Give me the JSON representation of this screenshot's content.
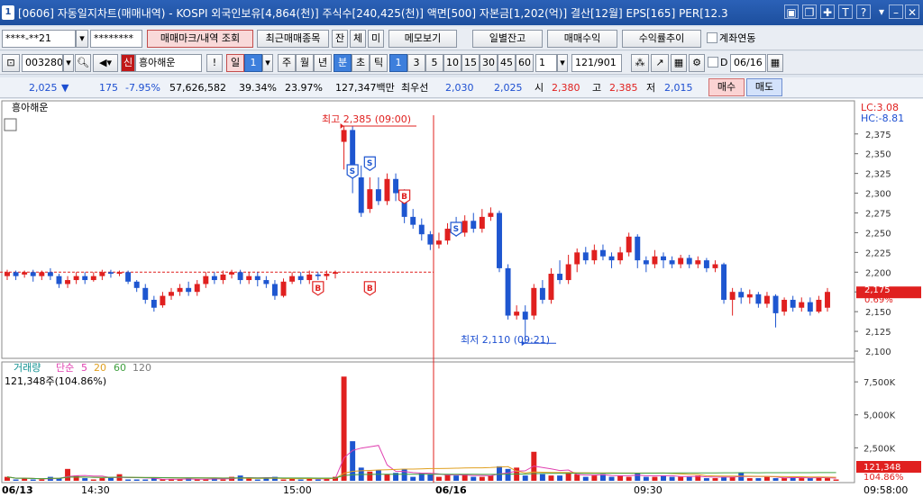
{
  "window": {
    "badge": "1",
    "title": "[0606] 자동일지차트(매매내역) - KOSPI 외국인보유[4,864(천)] 주식수[240,425(천)] 액면[500] 자본금[1,202(억)] 결산[12월] EPS[165] PER[12.3"
  },
  "toolbar1": {
    "account": "****-**21",
    "password": "********",
    "markbtn": "매매마크/내역 조회",
    "recent": "최근매매종목",
    "jan": "잔",
    "che": "체",
    "mi": "미",
    "memo": "메모보기",
    "daily": "일별잔고",
    "profit": "매매수익",
    "ratio": "수익률추이",
    "acctlink": "계좌연동"
  },
  "toolbar2": {
    "code": "003280",
    "shin": "신",
    "name": "흥아해운",
    "bang": "!",
    "il": "일",
    "il_num": "1",
    "ju": "주",
    "wol": "월",
    "nyeon": "년",
    "bun": "분",
    "cho": "초",
    "tik": "틱",
    "intervals": [
      "1",
      "3",
      "5",
      "10",
      "15",
      "30",
      "45",
      "60"
    ],
    "count": "1",
    "range": "121/901",
    "check_d": "D",
    "date": "06/16"
  },
  "quote": {
    "price": "2,025",
    "arrow": "▼",
    "change": "175",
    "rate": "-7.95%",
    "volume": "57,626,582",
    "r1": "39.34%",
    "r2": "23.97%",
    "amount": "127,347백만",
    "best_label": "최우선",
    "ask": "2,030",
    "bid": "2,025",
    "open_label": "시",
    "open": "2,380",
    "high_label": "고",
    "high": "2,385",
    "low_label": "저",
    "low": "2,015",
    "buy": "매수",
    "sell": "매도"
  },
  "chart": {
    "title": "흥아해운",
    "lc": "LC:3.08",
    "hc": "HC:-8.81",
    "high_note": "최고 2,385 (09:00)",
    "low_note": "최저 2,110 (09:21)",
    "last_price": "2,175",
    "last_rate": "0.69%",
    "price_ticks": [
      "2,375",
      "2,350",
      "2,325",
      "2,300",
      "2,275",
      "2,250",
      "2,225",
      "2,200",
      "2,175",
      "2,150",
      "2,125",
      "2,100"
    ],
    "vol_title": "거래량",
    "vol_ma_label": "단순",
    "vol_ma": [
      "5",
      "20",
      "60",
      "120"
    ],
    "vol_current": "121,348주(104.86%)",
    "vol_ticks": [
      "7,500K",
      "5,000K",
      "2,500K"
    ],
    "vol_last": "121,348",
    "vol_last_rate": "104.86%",
    "x_labels": [
      "06/13",
      "14:30",
      "15:00",
      "06/16",
      "09:30"
    ],
    "time": "09:58:00",
    "colors": {
      "up": "#e0201f",
      "down": "#1e56d0",
      "ma5": "#e040b0",
      "ma20": "#e0a020",
      "ma60": "#40a040",
      "ma120": "#7a7a7a"
    }
  },
  "chart_data": {
    "type": "candlestick",
    "title": "흥아해운",
    "x_range": [
      "06/13",
      "06/16 09:58"
    ],
    "ylim": [
      2100,
      2385
    ],
    "y_ticks": [
      2100,
      2125,
      2150,
      2175,
      2200,
      2225,
      2250,
      2275,
      2300,
      2325,
      2350,
      2375
    ],
    "high": {
      "value": 2385,
      "time": "09:00"
    },
    "low": {
      "value": 2110,
      "time": "09:21"
    },
    "last": 2175,
    "volume_ticks": [
      2500000,
      5000000,
      7500000
    ],
    "volume_last": 121348,
    "candles": [
      {
        "o": 2195,
        "c": 2200,
        "h": 2203,
        "l": 2190
      },
      {
        "o": 2200,
        "c": 2195,
        "h": 2202,
        "l": 2190
      },
      {
        "o": 2197,
        "c": 2200,
        "h": 2202,
        "l": 2193
      },
      {
        "o": 2200,
        "c": 2195,
        "h": 2203,
        "l": 2188
      },
      {
        "o": 2195,
        "c": 2200,
        "h": 2202,
        "l": 2190
      },
      {
        "o": 2200,
        "c": 2195,
        "h": 2205,
        "l": 2190
      },
      {
        "o": 2195,
        "c": 2185,
        "h": 2198,
        "l": 2180
      },
      {
        "o": 2185,
        "c": 2190,
        "h": 2195,
        "l": 2180
      },
      {
        "o": 2190,
        "c": 2195,
        "h": 2200,
        "l": 2185
      },
      {
        "o": 2195,
        "c": 2190,
        "h": 2200,
        "l": 2185
      },
      {
        "o": 2190,
        "c": 2195,
        "h": 2200,
        "l": 2188
      },
      {
        "o": 2195,
        "c": 2200,
        "h": 2203,
        "l": 2190
      },
      {
        "o": 2200,
        "c": 2198,
        "h": 2203,
        "l": 2193
      },
      {
        "o": 2198,
        "c": 2200,
        "h": 2202,
        "l": 2195
      },
      {
        "o": 2200,
        "c": 2188,
        "h": 2202,
        "l": 2185
      },
      {
        "o": 2188,
        "c": 2180,
        "h": 2190,
        "l": 2175
      },
      {
        "o": 2180,
        "c": 2165,
        "h": 2185,
        "l": 2160
      },
      {
        "o": 2165,
        "c": 2155,
        "h": 2170,
        "l": 2150
      },
      {
        "o": 2158,
        "c": 2170,
        "h": 2175,
        "l": 2155
      },
      {
        "o": 2170,
        "c": 2175,
        "h": 2180,
        "l": 2165
      },
      {
        "o": 2175,
        "c": 2180,
        "h": 2185,
        "l": 2170
      },
      {
        "o": 2180,
        "c": 2175,
        "h": 2188,
        "l": 2170
      },
      {
        "o": 2175,
        "c": 2185,
        "h": 2190,
        "l": 2170
      },
      {
        "o": 2185,
        "c": 2195,
        "h": 2200,
        "l": 2180
      },
      {
        "o": 2195,
        "c": 2190,
        "h": 2200,
        "l": 2185
      },
      {
        "o": 2190,
        "c": 2197,
        "h": 2202,
        "l": 2185
      },
      {
        "o": 2197,
        "c": 2200,
        "h": 2203,
        "l": 2192
      },
      {
        "o": 2200,
        "c": 2190,
        "h": 2203,
        "l": 2185
      },
      {
        "o": 2190,
        "c": 2195,
        "h": 2200,
        "l": 2185
      },
      {
        "o": 2195,
        "c": 2190,
        "h": 2200,
        "l": 2182
      },
      {
        "o": 2190,
        "c": 2185,
        "h": 2195,
        "l": 2180
      },
      {
        "o": 2185,
        "c": 2170,
        "h": 2190,
        "l": 2165
      },
      {
        "o": 2170,
        "c": 2188,
        "h": 2192,
        "l": 2168
      },
      {
        "o": 2188,
        "c": 2195,
        "h": 2200,
        "l": 2185
      },
      {
        "o": 2195,
        "c": 2190,
        "h": 2200,
        "l": 2185
      },
      {
        "o": 2190,
        "c": 2197,
        "h": 2202,
        "l": 2185
      },
      {
        "o": 2197,
        "c": 2195,
        "h": 2200,
        "l": 2190
      },
      {
        "o": 2195,
        "c": 2198,
        "h": 2202,
        "l": 2190
      },
      {
        "o": 2198,
        "c": 2200,
        "h": 2202,
        "l": 2192
      },
      {
        "o": 2365,
        "c": 2380,
        "h": 2385,
        "l": 2330
      },
      {
        "o": 2380,
        "c": 2320,
        "h": 2385,
        "l": 2300
      },
      {
        "o": 2320,
        "c": 2275,
        "h": 2335,
        "l": 2270
      },
      {
        "o": 2280,
        "c": 2305,
        "h": 2320,
        "l": 2275
      },
      {
        "o": 2305,
        "c": 2290,
        "h": 2320,
        "l": 2285
      },
      {
        "o": 2290,
        "c": 2318,
        "h": 2325,
        "l": 2285
      },
      {
        "o": 2318,
        "c": 2300,
        "h": 2325,
        "l": 2290
      },
      {
        "o": 2300,
        "c": 2270,
        "h": 2305,
        "l": 2262
      },
      {
        "o": 2270,
        "c": 2260,
        "h": 2280,
        "l": 2255
      },
      {
        "o": 2260,
        "c": 2248,
        "h": 2268,
        "l": 2240
      },
      {
        "o": 2248,
        "c": 2235,
        "h": 2252,
        "l": 2228
      },
      {
        "o": 2235,
        "c": 2240,
        "h": 2250,
        "l": 2230
      },
      {
        "o": 2240,
        "c": 2255,
        "h": 2262,
        "l": 2235
      },
      {
        "o": 2255,
        "c": 2250,
        "h": 2270,
        "l": 2245
      },
      {
        "o": 2250,
        "c": 2265,
        "h": 2272,
        "l": 2245
      },
      {
        "o": 2265,
        "c": 2255,
        "h": 2275,
        "l": 2250
      },
      {
        "o": 2255,
        "c": 2270,
        "h": 2280,
        "l": 2250
      },
      {
        "o": 2270,
        "c": 2275,
        "h": 2282,
        "l": 2265
      },
      {
        "o": 2275,
        "c": 2205,
        "h": 2278,
        "l": 2200
      },
      {
        "o": 2205,
        "c": 2145,
        "h": 2210,
        "l": 2140
      },
      {
        "o": 2145,
        "c": 2150,
        "h": 2158,
        "l": 2140
      },
      {
        "o": 2150,
        "c": 2140,
        "h": 2158,
        "l": 2110
      },
      {
        "o": 2145,
        "c": 2180,
        "h": 2185,
        "l": 2140
      },
      {
        "o": 2180,
        "c": 2165,
        "h": 2190,
        "l": 2160
      },
      {
        "o": 2165,
        "c": 2198,
        "h": 2205,
        "l": 2160
      },
      {
        "o": 2198,
        "c": 2190,
        "h": 2215,
        "l": 2185
      },
      {
        "o": 2190,
        "c": 2210,
        "h": 2222,
        "l": 2185
      },
      {
        "o": 2210,
        "c": 2225,
        "h": 2230,
        "l": 2200
      },
      {
        "o": 2225,
        "c": 2215,
        "h": 2232,
        "l": 2210
      },
      {
        "o": 2215,
        "c": 2228,
        "h": 2235,
        "l": 2210
      },
      {
        "o": 2228,
        "c": 2220,
        "h": 2235,
        "l": 2215
      },
      {
        "o": 2220,
        "c": 2215,
        "h": 2225,
        "l": 2205
      },
      {
        "o": 2215,
        "c": 2225,
        "h": 2232,
        "l": 2210
      },
      {
        "o": 2225,
        "c": 2245,
        "h": 2250,
        "l": 2220
      },
      {
        "o": 2245,
        "c": 2215,
        "h": 2248,
        "l": 2205
      },
      {
        "o": 2215,
        "c": 2210,
        "h": 2220,
        "l": 2200
      },
      {
        "o": 2210,
        "c": 2220,
        "h": 2228,
        "l": 2205
      },
      {
        "o": 2220,
        "c": 2215,
        "h": 2225,
        "l": 2205
      },
      {
        "o": 2215,
        "c": 2210,
        "h": 2220,
        "l": 2205
      },
      {
        "o": 2210,
        "c": 2218,
        "h": 2222,
        "l": 2205
      },
      {
        "o": 2218,
        "c": 2210,
        "h": 2222,
        "l": 2205
      },
      {
        "o": 2210,
        "c": 2215,
        "h": 2220,
        "l": 2205
      },
      {
        "o": 2215,
        "c": 2205,
        "h": 2218,
        "l": 2200
      },
      {
        "o": 2205,
        "c": 2210,
        "h": 2215,
        "l": 2200
      },
      {
        "o": 2210,
        "c": 2165,
        "h": 2212,
        "l": 2160
      },
      {
        "o": 2165,
        "c": 2175,
        "h": 2180,
        "l": 2145
      },
      {
        "o": 2175,
        "c": 2168,
        "h": 2180,
        "l": 2160
      },
      {
        "o": 2168,
        "c": 2172,
        "h": 2178,
        "l": 2160
      },
      {
        "o": 2172,
        "c": 2160,
        "h": 2175,
        "l": 2155
      },
      {
        "o": 2160,
        "c": 2170,
        "h": 2175,
        "l": 2155
      },
      {
        "o": 2170,
        "c": 2148,
        "h": 2172,
        "l": 2130
      },
      {
        "o": 2150,
        "c": 2165,
        "h": 2168,
        "l": 2145
      },
      {
        "o": 2165,
        "c": 2155,
        "h": 2170,
        "l": 2150
      },
      {
        "o": 2155,
        "c": 2162,
        "h": 2168,
        "l": 2150
      },
      {
        "o": 2162,
        "c": 2150,
        "h": 2168,
        "l": 2145
      },
      {
        "o": 2150,
        "c": 2165,
        "h": 2170,
        "l": 2148
      },
      {
        "o": 2155,
        "c": 2175,
        "h": 2180,
        "l": 2150
      }
    ],
    "volumes": [
      0.3,
      0.1,
      0.2,
      0.1,
      0.1,
      0.3,
      0.2,
      0.9,
      0.4,
      0.2,
      0.1,
      0.2,
      0.3,
      0.5,
      0.1,
      0.1,
      0.1,
      0.2,
      0.1,
      0.1,
      0.1,
      0.2,
      0.1,
      0.1,
      0.2,
      0.1,
      0.3,
      0.4,
      0.2,
      0.1,
      0.2,
      0.3,
      0.1,
      0.2,
      0.1,
      0.2,
      0.1,
      0.2,
      0.3,
      7.9,
      3.0,
      1.0,
      0.7,
      0.8,
      0.5,
      0.6,
      0.9,
      0.3,
      0.6,
      0.5,
      0.3,
      0.5,
      0.4,
      0.5,
      0.3,
      0.3,
      0.4,
      1.1,
      0.9,
      1.0,
      0.4,
      2.2,
      0.5,
      0.4,
      0.4,
      0.6,
      0.5,
      0.3,
      0.4,
      0.5,
      0.3,
      0.4,
      0.3,
      0.6,
      0.3,
      0.3,
      0.4,
      0.3,
      0.3,
      0.3,
      0.4,
      0.2,
      0.2,
      0.3,
      0.3,
      0.6,
      0.2,
      0.2,
      0.3,
      0.2,
      0.2,
      0.3,
      0.2,
      0.2,
      0.3,
      0.2,
      0.1
    ]
  }
}
